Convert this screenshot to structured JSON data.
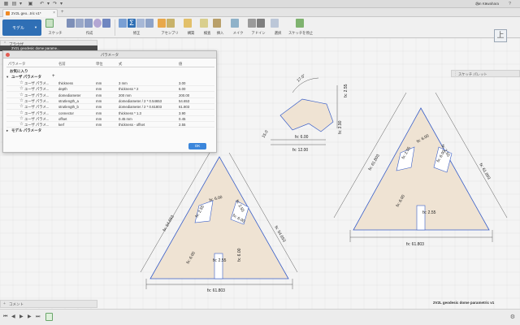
{
  "app": {
    "user_name": "Jun Kawahara",
    "document_tab": "2V2L geo...tric v1*",
    "document_name": "2V2L geodesic dome parametric v1"
  },
  "toolbar": {
    "workspace": "モデル",
    "groups": [
      {
        "label": "スケッチ"
      },
      {
        "label": "作成"
      },
      {
        "label": "修正"
      },
      {
        "label": "アセンブリ"
      },
      {
        "label": "構築"
      },
      {
        "label": "検査"
      },
      {
        "label": "挿入"
      },
      {
        "label": "メイク"
      },
      {
        "label": "アドイン"
      },
      {
        "label": "選択"
      },
      {
        "label": "スケッチを停止"
      }
    ]
  },
  "browser": {
    "title": "ブラウザ",
    "root_item": "2V2L geodesic dome parame..."
  },
  "viewcube": {
    "face": "上"
  },
  "sketch_palette": {
    "label": "スケッチ パレット"
  },
  "params_dialog": {
    "title": "パラメータ",
    "headers": {
      "param": "パラメータ",
      "name": "名前",
      "unit": "単位",
      "expr": "式",
      "value": "値"
    },
    "favorites": "お気に入り",
    "user_group": "ユーザ パラメータ",
    "model_group": "モデル パラメータ",
    "add_icon": "+",
    "rows": [
      {
        "type": "ユーザ パラメ...",
        "name": "thickness",
        "unit": "mm",
        "expr": "3 mm",
        "value": "3.00"
      },
      {
        "type": "ユーザ パラメ...",
        "name": "depth",
        "unit": "mm",
        "expr": "thickness * 2",
        "value": "6.00"
      },
      {
        "type": "ユーザ パラメ...",
        "name": "domediameter",
        "unit": "mm",
        "expr": "200 mm",
        "value": "200.00"
      },
      {
        "type": "ユーザ パラメ...",
        "name": "strutlength_a",
        "unit": "mm",
        "expr": "domediameter / 2 * 0.54653",
        "value": "54.653"
      },
      {
        "type": "ユーザ パラメ...",
        "name": "strutlength_b",
        "unit": "mm",
        "expr": "domediameter / 2 * 0.61803",
        "value": "61.803"
      },
      {
        "type": "ユーザ パラメ...",
        "name": "connector",
        "unit": "mm",
        "expr": "thickness * 1.3",
        "value": "3.90"
      },
      {
        "type": "ユーザ パラメ...",
        "name": "offset",
        "unit": "mm",
        "expr": "0.45 mm",
        "value": "0.45"
      },
      {
        "type": "ユーザ パラメ...",
        "name": "kerf",
        "unit": "mm",
        "expr": "thickness - offset",
        "value": "2.55"
      }
    ],
    "ok_label": "OK"
  },
  "dimensions": {
    "left_base": "fx: 61.803",
    "left_side_l": "fx: 54.653",
    "left_side_r": "fx: 54.653",
    "left_slot_a": "fx: 2.55",
    "left_slot_b": "fx: 6.00",
    "left_slot_c": "fx: 2.55",
    "left_slot_d": "fx: 6.00",
    "left_slot_e": "fx: 6.00",
    "left_slot_f": "fx: 2.55",
    "left_slot_g": "fx: 6.00",
    "right_base": "fx: 61.803",
    "right_side_l": "fx: 61.803",
    "right_side_r": "fx: 61.803",
    "right_slot_a": "fx: 2.55",
    "right_slot_b": "fx: 6.00",
    "right_slot_c": "fx: 2.55",
    "right_slot_d": "fx: 6.00",
    "right_slot_e": "fx: 6.00",
    "right_slot_f": "fx: 2.55",
    "top_angle": "17.0°",
    "top_a": "fx: 2.55",
    "top_b": "fx: 3.90",
    "top_c": "fx: 6.00",
    "top_d": "fx: 12.00",
    "top_e": "15.0"
  },
  "comments": {
    "label": "コメント"
  },
  "colors": {
    "accent": "#2f6fb5",
    "plate_fill": "#efe3d3",
    "sketch_line": "#3a5fc8",
    "dim_line": "#333333"
  }
}
